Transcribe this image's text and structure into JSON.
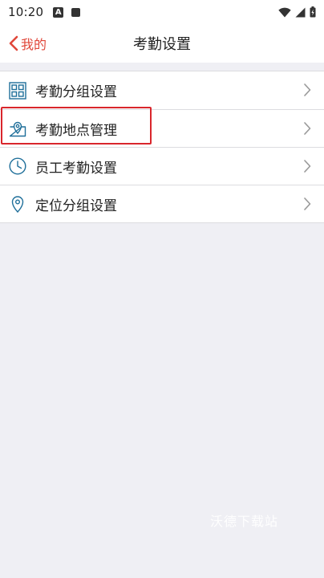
{
  "status_bar": {
    "time": "10:20",
    "left_icons": [
      "a-notification-icon",
      "square-notification-icon"
    ],
    "right_icons": [
      "wifi-icon",
      "cell-signal-icon",
      "battery-icon"
    ]
  },
  "header": {
    "back_label": "我的",
    "title": "考勤设置",
    "accent_color": "#e0473a"
  },
  "menu": {
    "items": [
      {
        "label": "考勤分组设置",
        "icon": "grid-icon"
      },
      {
        "label": "考勤地点管理",
        "icon": "map-pin-icon"
      },
      {
        "label": "员工考勤设置",
        "icon": "clock-icon"
      },
      {
        "label": "定位分组设置",
        "icon": "location-icon"
      }
    ]
  },
  "highlight_color": "#d9262c",
  "watermark": "沃德下载站"
}
